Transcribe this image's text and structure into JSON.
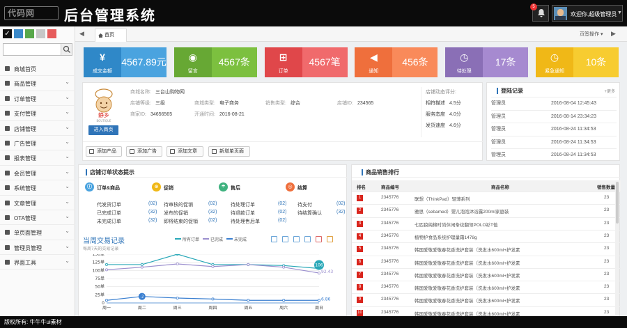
{
  "header": {
    "logo": "代码网",
    "title": "后台管理系统",
    "notifications": "5",
    "welcome": "欢迎你,超级管理员"
  },
  "themes": [
    {
      "color": "#111111",
      "check": "✓"
    },
    {
      "color": "#3b89c9",
      "check": ""
    },
    {
      "color": "#58a84a",
      "check": ""
    },
    {
      "color": "#c7c7c7",
      "check": ""
    },
    {
      "color": "#e65b5b",
      "check": ""
    }
  ],
  "search": {
    "placeholder": ""
  },
  "menu": [
    {
      "label": "商城首页",
      "icon": "home-icon",
      "arrow": ""
    },
    {
      "label": "商品管理",
      "icon": "box-icon",
      "arrow": "⌄"
    },
    {
      "label": "订单管理",
      "icon": "list-icon",
      "arrow": "⌄"
    },
    {
      "label": "支付管理",
      "icon": "card-icon",
      "arrow": "⌄"
    },
    {
      "label": "店铺管理",
      "icon": "store-icon",
      "arrow": "⌄"
    },
    {
      "label": "广告管理",
      "icon": "ad-icon",
      "arrow": "⌄"
    },
    {
      "label": "报表管理",
      "icon": "chart-icon",
      "arrow": "⌄"
    },
    {
      "label": "会员管理",
      "icon": "user-icon",
      "arrow": "⌄"
    },
    {
      "label": "系统管理",
      "icon": "gear-icon",
      "arrow": "⌄"
    },
    {
      "label": "文章管理",
      "icon": "doc-icon",
      "arrow": "⌄"
    },
    {
      "label": "OTA管理",
      "icon": "pin-icon",
      "arrow": "⌄"
    },
    {
      "label": "单页面管理",
      "icon": "page-icon",
      "arrow": "⌄"
    },
    {
      "label": "管理员管理",
      "icon": "admin-icon",
      "arrow": "⌄"
    },
    {
      "label": "界面工具",
      "icon": "tool-icon",
      "arrow": "⌄"
    }
  ],
  "tabs": {
    "home": "首页",
    "page_ops": "页签操作 ▾",
    "prev": "◀",
    "next": "▶"
  },
  "stats": [
    {
      "label": "成交金额",
      "value": "4567.89元",
      "icon": "¥",
      "left": "#2f88c8",
      "right": "#4aa3df"
    },
    {
      "label": "留言",
      "value": "4567条",
      "icon": "◉",
      "left": "#67a834",
      "right": "#7cc03f"
    },
    {
      "label": "订单",
      "value": "4567笔",
      "icon": "⊞",
      "left": "#e0474a",
      "right": "#f06a6c"
    },
    {
      "label": "通知",
      "value": "456条",
      "icon": "◀",
      "left": "#ef6f3c",
      "right": "#f98a5a"
    },
    {
      "label": "待处理",
      "value": "17条",
      "icon": "◷",
      "left": "#8a6fb6",
      "right": "#a68ad0"
    },
    {
      "label": "紧急通知",
      "value": "10条",
      "icon": "◷",
      "left": "#f0b817",
      "right": "#f7cc30"
    }
  ],
  "shop": {
    "enter": "进入商页",
    "logo_text": "静乡",
    "logo_sub": "BOUTIQUE",
    "fields": [
      {
        "k": "商城名称:",
        "v": "三台山购物网"
      },
      {
        "k": "店铺等级:",
        "v": "三级"
      },
      {
        "k": "商城类型:",
        "v": "电子商务"
      },
      {
        "k": "销售类型:",
        "v": "综合"
      },
      {
        "k": "店铺ID:",
        "v": "234565"
      },
      {
        "k": "商家ID:",
        "v": "34656565"
      },
      {
        "k": "开通时间:",
        "v": "2016-08-21"
      }
    ],
    "rating_title": "店铺动态评分:",
    "ratings": [
      {
        "k": "相符描述",
        "v": "4.5分"
      },
      {
        "k": "服务态度",
        "v": "4.0分"
      },
      {
        "k": "发货速度",
        "v": "4.6分"
      }
    ],
    "buttons": [
      "添加产品",
      "添加广告",
      "添加文章",
      "新增单页面"
    ]
  },
  "login": {
    "title": "登陆记录",
    "more": "+更多",
    "rows": [
      {
        "u": "管理员",
        "d": "2016-08-04 12:45:43"
      },
      {
        "u": "管理员",
        "d": "2016-08-14 23:34:23"
      },
      {
        "u": "管理员",
        "d": "2016-08-24 11:34:53"
      },
      {
        "u": "管理员",
        "d": "2016-08-24 11:34:53"
      },
      {
        "u": "管理员",
        "d": "2016-08-24 11:34:53"
      },
      {
        "u": "管理员",
        "d": "2016-08-24 11:34:53"
      }
    ]
  },
  "orders": {
    "title": "店铺订单状态提示",
    "cats": [
      {
        "label": "订单&商品",
        "icon": "ⓘ",
        "color": "#4aa3df"
      },
      {
        "label": "促销",
        "icon": "⊛",
        "color": "#f0b817"
      },
      {
        "label": "售后",
        "icon": "☂",
        "color": "#3fb27f"
      },
      {
        "label": "结算",
        "icon": "◎",
        "color": "#ef6f3c"
      }
    ],
    "col1": [
      {
        "l": "代发货订单",
        "c": "(02)"
      },
      {
        "l": "已完成订单",
        "c": "(32)"
      },
      {
        "l": "未完成订单",
        "c": "(32)"
      }
    ],
    "col2": [
      {
        "l": "待审核的促销",
        "c": "(02)"
      },
      {
        "l": "发布的促销",
        "c": "(32)"
      },
      {
        "l": "即将结束的促销",
        "c": "(02)"
      }
    ],
    "col3": [
      {
        "l": "待处理订单",
        "c": "(02)"
      },
      {
        "l": "待退款订单",
        "c": "(02)"
      },
      {
        "l": "待处理售后单",
        "c": "(02)"
      }
    ],
    "col4": [
      {
        "l": "待支付",
        "c": "(02)"
      },
      {
        "l": "待结算确认",
        "c": "(32)"
      }
    ],
    "chart_title": "当周交易记录",
    "chart_sub": "每周7天的交易记录",
    "legend": [
      "所有订单",
      "已完成",
      "未完成"
    ]
  },
  "chart_data": {
    "type": "line",
    "x": [
      "周一",
      "周二",
      "周三",
      "周四",
      "周五",
      "周六",
      "周日"
    ],
    "ylim": [
      0,
      150
    ],
    "yticks": [
      "0",
      "25单",
      "50单",
      "75单",
      "100单",
      "125单",
      "150单"
    ],
    "series": [
      {
        "name": "所有订单",
        "color": "#29a8b8",
        "values": [
          118,
          118,
          150,
          118,
          118,
          115,
          106
        ]
      },
      {
        "name": "已完成",
        "color": "#9b8fce",
        "values": [
          102,
          110,
          120,
          112,
          118,
          110,
          92
        ]
      },
      {
        "name": "未完成",
        "color": "#3a7fd0",
        "values": [
          8,
          20,
          15,
          12,
          8,
          8,
          8
        ]
      }
    ],
    "labels": {
      "max": "150",
      "last": "106",
      "min": "-2",
      "last_done": "92.43",
      "last_undone": "6.86"
    }
  },
  "sales": {
    "title": "商品销售排行",
    "headers": [
      "排名",
      "商品编号",
      "商品名称",
      "销售数量"
    ],
    "rows": [
      {
        "r": "1",
        "id": "2345776",
        "n": "联想（ThinkPad）轻薄系列",
        "q": "23"
      },
      {
        "r": "2",
        "id": "2345776",
        "n": "雅思（sebamed）婴儿泡泡沐浴露200ml家庭装",
        "q": "23"
      },
      {
        "r": "3",
        "id": "2345776",
        "n": "七匹狼纯棉时尚休闲条纹翻领POLO衫T恤",
        "q": "23"
      },
      {
        "r": "4",
        "id": "2345776",
        "n": "植物护食品系统护理量霜1478g",
        "q": "23"
      },
      {
        "r": "5",
        "id": "2345776",
        "n": "韩国爱敬爱敬春花香洗护套装（洗发水600ml+护发素",
        "q": "23"
      },
      {
        "r": "6",
        "id": "2345776",
        "n": "韩国爱敬爱敬春花香洗护套装（洗发水600ml+护发素",
        "q": "23"
      },
      {
        "r": "7",
        "id": "2345776",
        "n": "韩国爱敬爱敬春花香洗护套装（洗发水600ml+护发素",
        "q": "23"
      },
      {
        "r": "8",
        "id": "2345776",
        "n": "韩国爱敬爱敬春花香洗护套装（洗发水600ml+护发素",
        "q": "23"
      },
      {
        "r": "9",
        "id": "2345776",
        "n": "韩国爱敬爱敬春花香洗护套装（洗发水600ml+护发素",
        "q": "23"
      },
      {
        "r": "10",
        "id": "2345776",
        "n": "韩国爱敬爱敬春花香洗护套装（洗发水600ml+护发素",
        "q": "23"
      }
    ]
  },
  "footer": "版权所有: 牛牛牛ui素材"
}
